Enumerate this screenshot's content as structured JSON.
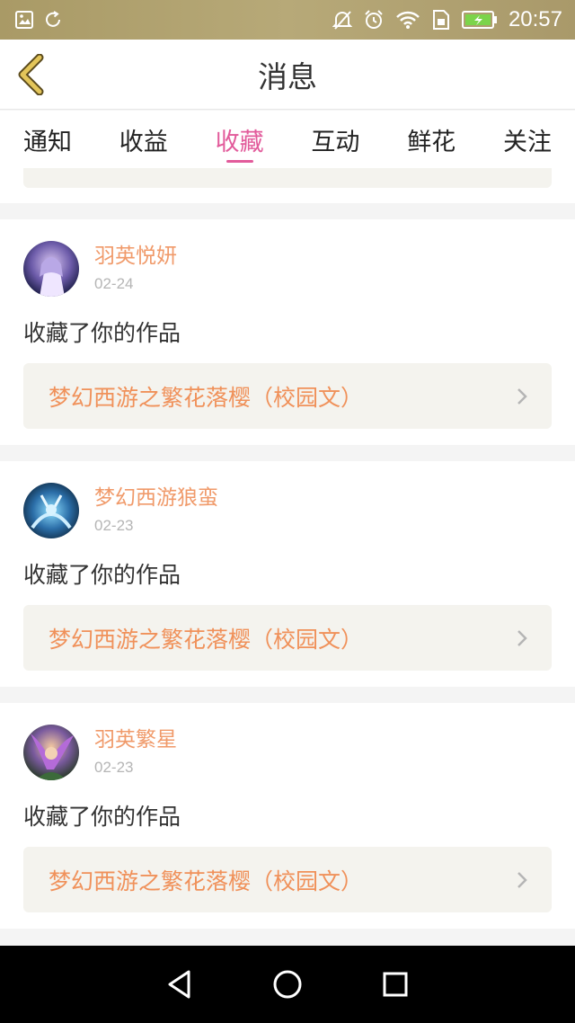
{
  "status_bar": {
    "time": "20:57",
    "icons": [
      "image-icon",
      "sync-icon",
      "mute-icon",
      "alarm-icon",
      "wifi-icon",
      "sim-icon",
      "battery-charging-icon"
    ]
  },
  "header": {
    "title": "消息",
    "back_icon": "chevron-left-icon",
    "accent_color": "#d8b84a"
  },
  "tabs": [
    {
      "label": "通知",
      "active": false
    },
    {
      "label": "收益",
      "active": false
    },
    {
      "label": "收藏",
      "active": true
    },
    {
      "label": "互动",
      "active": false
    },
    {
      "label": "鲜花",
      "active": false
    },
    {
      "label": "关注",
      "active": false
    }
  ],
  "colors": {
    "active_tab": "#e25b9b",
    "username": "#f09a6a",
    "work_title": "#f0915a",
    "date": "#b5b5b5"
  },
  "messages": [
    {
      "username": "羽英悦妍",
      "date": "02-24",
      "action": "收藏了你的作品",
      "work_title": "梦幻西游之繁花落樱（校园文）"
    },
    {
      "username": "梦幻西游狼蛮",
      "date": "02-23",
      "action": "收藏了你的作品",
      "work_title": "梦幻西游之繁花落樱（校园文）"
    },
    {
      "username": "羽英繁星",
      "date": "02-23",
      "action": "收藏了你的作品",
      "work_title": "梦幻西游之繁花落樱（校园文）"
    }
  ],
  "nav_bar": {
    "buttons": [
      "back-triangle-icon",
      "home-circle-icon",
      "recents-square-icon"
    ]
  }
}
